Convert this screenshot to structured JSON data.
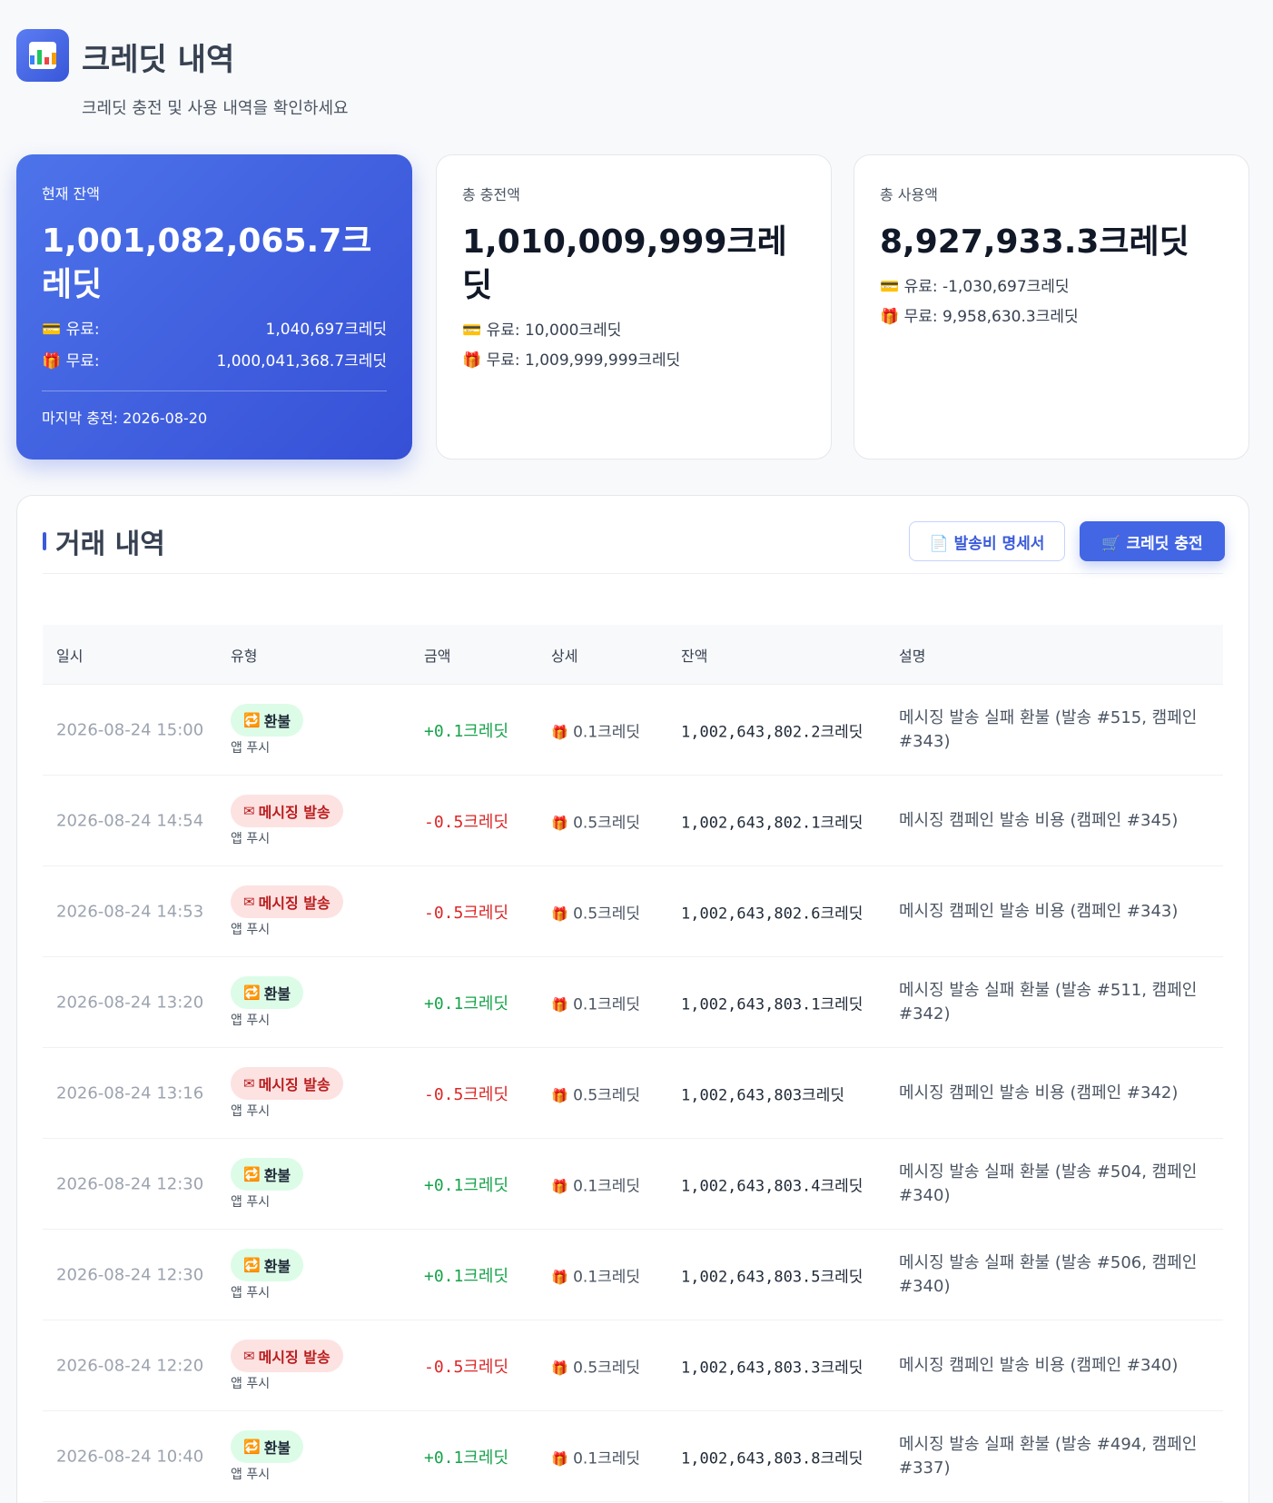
{
  "header": {
    "title": "크레딧 내역",
    "subtitle": "크레딧 충전 및 사용 내역을 확인하세요"
  },
  "cards": {
    "balance": {
      "label": "현재 잔액",
      "value": "1,001,082,065.7크레딧",
      "paid_label": "💳 유료:",
      "paid_value": "1,040,697크레딧",
      "free_label": "🎁 무료:",
      "free_value": "1,000,041,368.7크레딧",
      "last_charge": "마지막 충전: 2026-08-20"
    },
    "total_charge": {
      "label": "총 충전액",
      "value": "1,010,009,999크레딧",
      "paid": "💳 유료: 10,000크레딧",
      "free": "🎁 무료: 1,009,999,999크레딧"
    },
    "total_used": {
      "label": "총 사용액",
      "value": "8,927,933.3크레딧",
      "paid": "💳 유료: -1,030,697크레딧",
      "free": "🎁 무료: 9,958,630.3크레딧"
    }
  },
  "panel": {
    "title": "거래 내역",
    "invoice_button": "📄 발송비 명세서",
    "charge_button": "🛒 크레딧 충전"
  },
  "table": {
    "headers": [
      "일시",
      "유형",
      "금액",
      "상세",
      "잔액",
      "설명"
    ],
    "rows": [
      {
        "date": "2026-08-24 15:00",
        "type": "환불",
        "kind": "refund",
        "sub": "앱 푸시",
        "amount": "+0.1크레딧",
        "detail": "0.1크레딧",
        "balance": "1,002,643,802.2크레딧",
        "desc": "메시징 발송 실패 환불 (발송 #515, 캠페인 #343)"
      },
      {
        "date": "2026-08-24 14:54",
        "type": "메시징 발송",
        "kind": "send",
        "sub": "앱 푸시",
        "amount": "-0.5크레딧",
        "detail": "0.5크레딧",
        "balance": "1,002,643,802.1크레딧",
        "desc": "메시징 캠페인 발송 비용 (캠페인 #345)"
      },
      {
        "date": "2026-08-24 14:53",
        "type": "메시징 발송",
        "kind": "send",
        "sub": "앱 푸시",
        "amount": "-0.5크레딧",
        "detail": "0.5크레딧",
        "balance": "1,002,643,802.6크레딧",
        "desc": "메시징 캠페인 발송 비용 (캠페인 #343)"
      },
      {
        "date": "2026-08-24 13:20",
        "type": "환불",
        "kind": "refund",
        "sub": "앱 푸시",
        "amount": "+0.1크레딧",
        "detail": "0.1크레딧",
        "balance": "1,002,643,803.1크레딧",
        "desc": "메시징 발송 실패 환불 (발송 #511, 캠페인 #342)"
      },
      {
        "date": "2026-08-24 13:16",
        "type": "메시징 발송",
        "kind": "send",
        "sub": "앱 푸시",
        "amount": "-0.5크레딧",
        "detail": "0.5크레딧",
        "balance": "1,002,643,803크레딧",
        "desc": "메시징 캠페인 발송 비용 (캠페인 #342)"
      },
      {
        "date": "2026-08-24 12:30",
        "type": "환불",
        "kind": "refund",
        "sub": "앱 푸시",
        "amount": "+0.1크레딧",
        "detail": "0.1크레딧",
        "balance": "1,002,643,803.4크레딧",
        "desc": "메시징 발송 실패 환불 (발송 #504, 캠페인 #340)"
      },
      {
        "date": "2026-08-24 12:30",
        "type": "환불",
        "kind": "refund",
        "sub": "앱 푸시",
        "amount": "+0.1크레딧",
        "detail": "0.1크레딧",
        "balance": "1,002,643,803.5크레딧",
        "desc": "메시징 발송 실패 환불 (발송 #506, 캠페인 #340)"
      },
      {
        "date": "2026-08-24 12:20",
        "type": "메시징 발송",
        "kind": "send",
        "sub": "앱 푸시",
        "amount": "-0.5크레딧",
        "detail": "0.5크레딧",
        "balance": "1,002,643,803.3크레딧",
        "desc": "메시징 캠페인 발송 비용 (캠페인 #340)"
      },
      {
        "date": "2026-08-24 10:40",
        "type": "환불",
        "kind": "refund",
        "sub": "앱 푸시",
        "amount": "+0.1크레딧",
        "detail": "0.1크레딧",
        "balance": "1,002,643,803.8크레딧",
        "desc": "메시징 발송 실패 환불 (발송 #494, 캠페인 #337)"
      }
    ]
  },
  "colors": {
    "accent": "#4366e4",
    "refund_badge": "#dcfce7",
    "send_badge": "#fde2e2",
    "positive": "#16a34a",
    "negative": "#dc2626"
  }
}
